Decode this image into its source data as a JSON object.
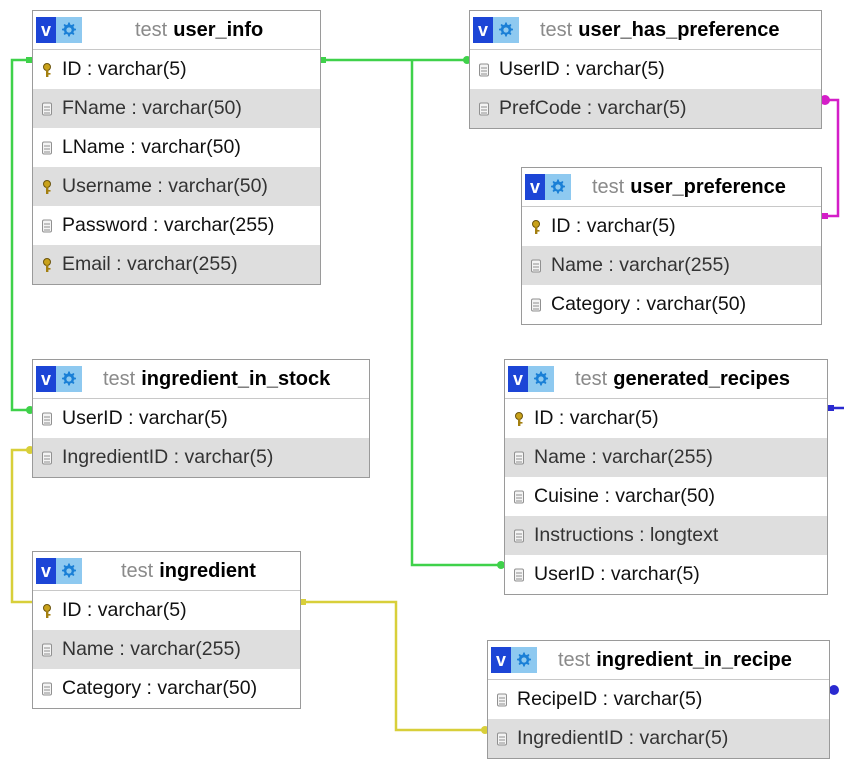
{
  "database": "test",
  "colors": {
    "relation_green": "#3fd14a",
    "relation_magenta": "#d41ec8",
    "relation_yellow": "#d8cf3a",
    "relation_blue": "#2a2ad0",
    "badge_blue": "#1c45d6",
    "gear_blue": "#8ec9f0",
    "row_alt": "#dedede"
  },
  "tables": [
    {
      "name": "user_info",
      "fields": [
        {
          "text": "ID : varchar(5)",
          "key": true
        },
        {
          "text": "FName : varchar(50)",
          "key": false
        },
        {
          "text": "LName : varchar(50)",
          "key": false
        },
        {
          "text": "Username : varchar(50)",
          "key": true
        },
        {
          "text": "Password : varchar(255)",
          "key": false
        },
        {
          "text": "Email : varchar(255)",
          "key": true
        }
      ]
    },
    {
      "name": "user_has_preference",
      "fields": [
        {
          "text": "UserID : varchar(5)",
          "key": false
        },
        {
          "text": "PrefCode : varchar(5)",
          "key": false
        }
      ]
    },
    {
      "name": "user_preference",
      "fields": [
        {
          "text": "ID : varchar(5)",
          "key": true
        },
        {
          "text": "Name : varchar(255)",
          "key": false
        },
        {
          "text": "Category : varchar(50)",
          "key": false
        }
      ]
    },
    {
      "name": "ingredient_in_stock",
      "fields": [
        {
          "text": "UserID : varchar(5)",
          "key": false
        },
        {
          "text": "IngredientID : varchar(5)",
          "key": false
        }
      ]
    },
    {
      "name": "generated_recipes",
      "fields": [
        {
          "text": "ID : varchar(5)",
          "key": true
        },
        {
          "text": "Name : varchar(255)",
          "key": false
        },
        {
          "text": "Cuisine : varchar(50)",
          "key": false
        },
        {
          "text": "Instructions : longtext",
          "key": false
        },
        {
          "text": "UserID : varchar(5)",
          "key": false
        }
      ]
    },
    {
      "name": "ingredient",
      "fields": [
        {
          "text": "ID : varchar(5)",
          "key": true
        },
        {
          "text": "Name : varchar(255)",
          "key": false
        },
        {
          "text": "Category : varchar(50)",
          "key": false
        }
      ]
    },
    {
      "name": "ingredient_in_recipe",
      "fields": [
        {
          "text": "RecipeID : varchar(5)",
          "key": false
        },
        {
          "text": "IngredientID : varchar(5)",
          "key": false
        }
      ]
    }
  ]
}
